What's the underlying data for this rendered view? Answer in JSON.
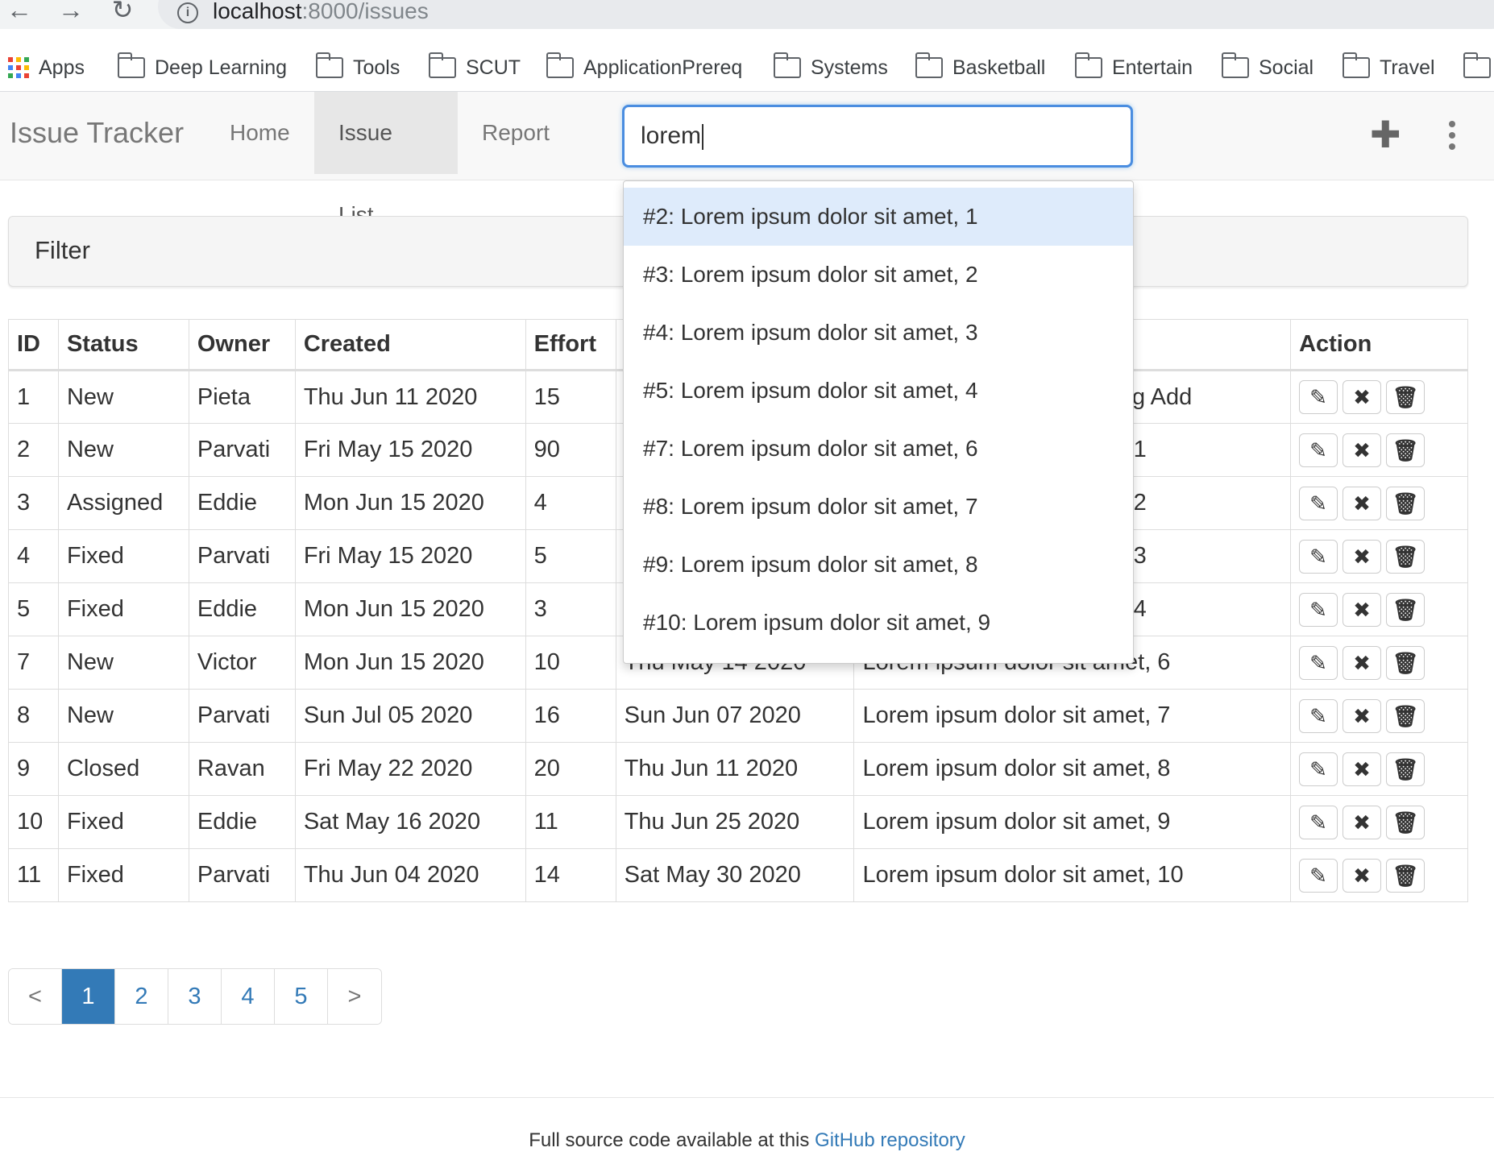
{
  "browser": {
    "url_host": "localhost",
    "url_path": ":8000/issues",
    "bookmarks": [
      "Apps",
      "Deep Learning",
      "Tools",
      "SCUT",
      "ApplicationPrereq",
      "Systems",
      "Basketball",
      "Entertain",
      "Social",
      "Travel"
    ]
  },
  "navbar": {
    "brand": "Issue Tracker",
    "links": [
      "Home",
      "Issue List",
      "Report"
    ],
    "active_link": "Issue List",
    "search_value": "lorem"
  },
  "search_suggestions": [
    "#2: Lorem ipsum dolor sit amet, 1",
    "#3: Lorem ipsum dolor sit amet, 2",
    "#4: Lorem ipsum dolor sit amet, 3",
    "#5: Lorem ipsum dolor sit amet, 4",
    "#7: Lorem ipsum dolor sit amet, 6",
    "#8: Lorem ipsum dolor sit amet, 7",
    "#9: Lorem ipsum dolor sit amet, 8",
    "#10: Lorem ipsum dolor sit amet, 9"
  ],
  "filter": {
    "title": "Filter"
  },
  "table": {
    "headers": [
      "ID",
      "Status",
      "Owner",
      "Created",
      "Effort",
      "",
      "",
      "Action"
    ],
    "rows": [
      [
        "1",
        "New",
        "Pieta",
        "Thu Jun 11 2020",
        "15",
        "",
        "ing Add"
      ],
      [
        "2",
        "New",
        "Parvati",
        "Fri May 15 2020",
        "90",
        "",
        "t, 1"
      ],
      [
        "3",
        "Assigned",
        "Eddie",
        "Mon Jun 15 2020",
        "4",
        "",
        "t, 2"
      ],
      [
        "4",
        "Fixed",
        "Parvati",
        "Fri May 15 2020",
        "5",
        "",
        "t, 3"
      ],
      [
        "5",
        "Fixed",
        "Eddie",
        "Mon Jun 15 2020",
        "3",
        "",
        "t, 4"
      ],
      [
        "7",
        "New",
        "Victor",
        "Mon Jun 15 2020",
        "10",
        "Thu May 14 2020",
        "Lorem ipsum dolor sit amet, 6"
      ],
      [
        "8",
        "New",
        "Parvati",
        "Sun Jul 05 2020",
        "16",
        "Sun Jun 07 2020",
        "Lorem ipsum dolor sit amet, 7"
      ],
      [
        "9",
        "Closed",
        "Ravan",
        "Fri May 22 2020",
        "20",
        "Thu Jun 11 2020",
        "Lorem ipsum dolor sit amet, 8"
      ],
      [
        "10",
        "Fixed",
        "Eddie",
        "Sat May 16 2020",
        "11",
        "Thu Jun 25 2020",
        "Lorem ipsum dolor sit amet, 9"
      ],
      [
        "11",
        "Fixed",
        "Parvati",
        "Thu Jun 04 2020",
        "14",
        "Sat May 30 2020",
        "Lorem ipsum dolor sit amet, 10"
      ]
    ],
    "action_icons": [
      "edit-icon",
      "close-icon",
      "trash-icon"
    ]
  },
  "pagination": {
    "prev": "<",
    "pages": [
      "1",
      "2",
      "3",
      "4",
      "5"
    ],
    "active": "1",
    "next": ">"
  },
  "footer": {
    "text": "Full source code available at this ",
    "link": "GitHub repository"
  },
  "colors": {
    "accent": "#337ab7",
    "search_focus": "#4a8de0",
    "suggestion_highlight": "#deebfb",
    "apps_grid": [
      "#ea4335",
      "#fbbc04",
      "#34a853",
      "#4285f4",
      "#ea4335",
      "#fbbc04",
      "#34a853",
      "#4285f4",
      "#ea4335"
    ]
  }
}
